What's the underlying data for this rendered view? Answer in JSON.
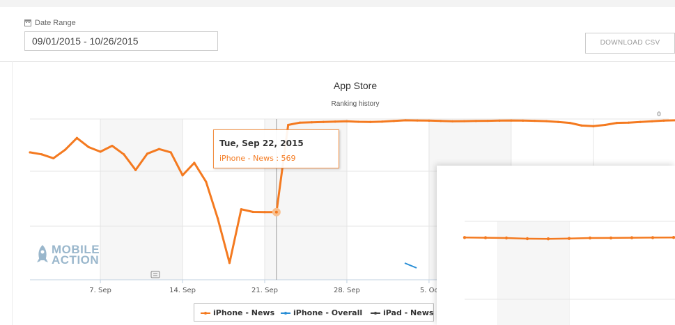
{
  "toolbar": {
    "date_range_label": "Date Range",
    "date_range_value": "09/01/2015 - 10/26/2015",
    "download_label": "DOWNLOAD CSV"
  },
  "logo": {
    "line1": "MOBILE",
    "line2": "ACTION"
  },
  "tooltip": {
    "date": "Tue, Sep 22, 2015",
    "series": "iPhone - News",
    "value": "569"
  },
  "colors": {
    "iphone_news": "#f47a20",
    "iphone_overall": "#2b8fd6",
    "ipad_news": "#444444"
  },
  "chart_data": {
    "type": "line",
    "title": "App Store",
    "subtitle": "Ranking history",
    "x_ticks": [
      "7. Sep",
      "14. Sep",
      "21. Sep",
      "28. Sep",
      "5. Oc"
    ],
    "y_ticks_visible": [
      "0"
    ],
    "y_reversed": true,
    "series": [
      {
        "name": "iPhone - News",
        "x": [
          "2015-09-01",
          "2015-09-02",
          "2015-09-03",
          "2015-09-04",
          "2015-09-05",
          "2015-09-06",
          "2015-09-07",
          "2015-09-08",
          "2015-09-09",
          "2015-09-10",
          "2015-09-11",
          "2015-09-12",
          "2015-09-13",
          "2015-09-14",
          "2015-09-15",
          "2015-09-16",
          "2015-09-17",
          "2015-09-18",
          "2015-09-19",
          "2015-09-20",
          "2015-09-21",
          "2015-09-22",
          "2015-09-23",
          "2015-09-24",
          "2015-09-25",
          "2015-09-26",
          "2015-09-27",
          "2015-09-28",
          "2015-09-29",
          "2015-09-30",
          "2015-10-01",
          "2015-10-02",
          "2015-10-03",
          "2015-10-04",
          "2015-10-05",
          "2015-10-06",
          "2015-10-07",
          "2015-10-08",
          "2015-10-09",
          "2015-10-10",
          "2015-10-11",
          "2015-10-12",
          "2015-10-13",
          "2015-10-14",
          "2015-10-15",
          "2015-10-16",
          "2015-10-17",
          "2015-10-18",
          "2015-10-19",
          "2015-10-20",
          "2015-10-21",
          "2015-10-22",
          "2015-10-23",
          "2015-10-24",
          "2015-10-25",
          "2015-10-26"
        ],
        "y": [
          204,
          216,
          240,
          188,
          116,
          172,
          200,
          164,
          216,
          312,
          212,
          184,
          204,
          344,
          268,
          384,
          608,
          880,
          552,
          568,
          569,
          569,
          36,
          22,
          20,
          18,
          16,
          14,
          17,
          18,
          16,
          12,
          8,
          9,
          10,
          12,
          14,
          13,
          12,
          11,
          10,
          9,
          10,
          11,
          13,
          18,
          24,
          40,
          44,
          36,
          24,
          22,
          18,
          14,
          10,
          8
        ]
      },
      {
        "name": "iPhone - Overall"
      },
      {
        "name": "iPad - News"
      }
    ],
    "legend_position": "bottom-center"
  }
}
